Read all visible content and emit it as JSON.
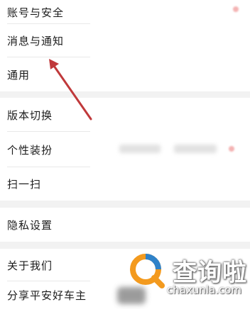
{
  "settings": {
    "items": [
      {
        "label": "账号与安全"
      },
      {
        "label": "消息与通知"
      },
      {
        "label": "通用"
      },
      {
        "label": "版本切换"
      },
      {
        "label": "个性装扮"
      },
      {
        "label": "扫一扫"
      },
      {
        "label": "隐私设置"
      },
      {
        "label": "关于我们"
      },
      {
        "label": "分享平安好车主"
      }
    ]
  },
  "watermark": {
    "title": "查询啦",
    "url": "chaxunla.com"
  },
  "colors": {
    "background": "#f2f2f2",
    "row": "#ffffff",
    "arrow": "#c0393b",
    "logo_orange": "#f39a1e",
    "logo_blue": "#2f82c9"
  }
}
